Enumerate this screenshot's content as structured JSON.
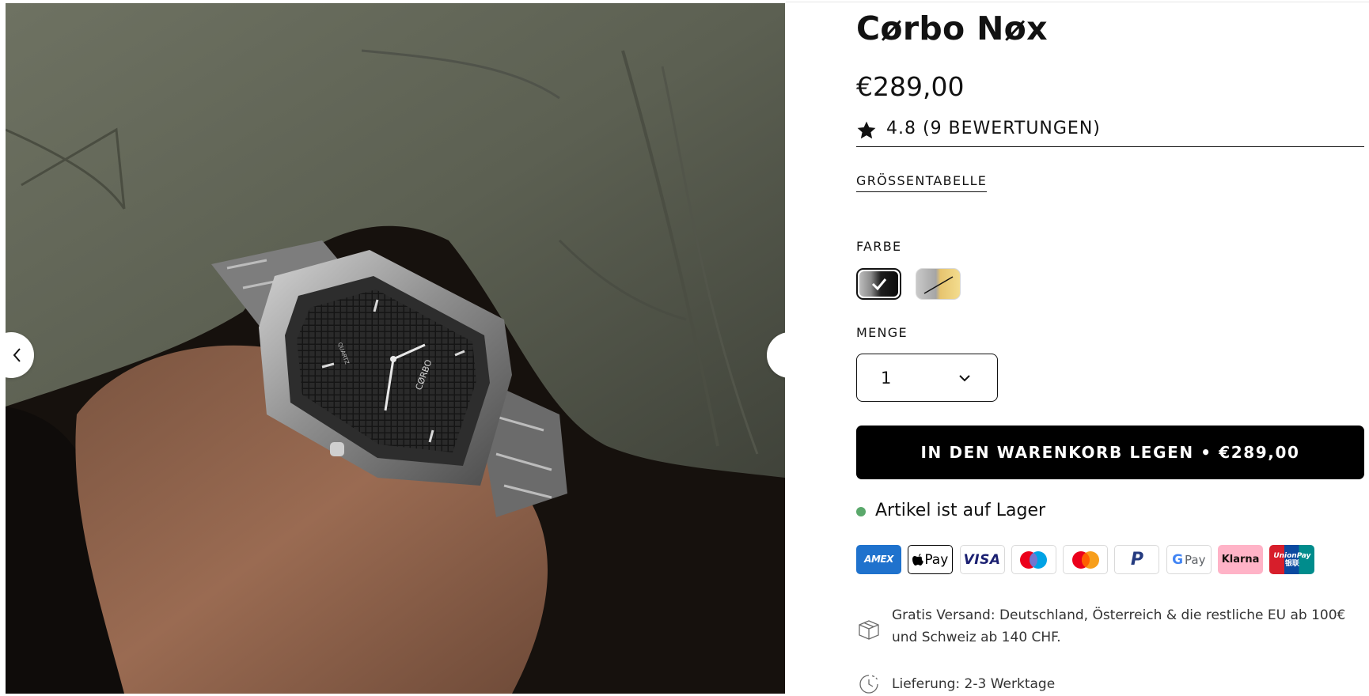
{
  "product": {
    "title": "Cørbo Nøx",
    "price": "€289,00",
    "rating_text": "4.8 (9 BEWERTUNGEN)",
    "size_chart_label": "GRÖSSENTABELLE"
  },
  "options": {
    "color_label": "FARBE",
    "colors": [
      {
        "name": "black",
        "selected": true
      },
      {
        "name": "gold",
        "selected": false,
        "sold_out": true
      }
    ],
    "quantity_label": "MENGE",
    "quantity_value": "1"
  },
  "cart": {
    "button_label": "IN DEN WARENKORB LEGEN • €289,00"
  },
  "stock": {
    "text": "Artikel ist auf Lager",
    "color": "#5aa86b"
  },
  "payments": {
    "amex": "AMEX",
    "applepay": "Pay",
    "visa": "VISA",
    "paypal": "P",
    "gpay": "Pay",
    "gpay_g": "G",
    "klarna": "Klarna",
    "unionpay_1": "UnionPay",
    "unionpay_2": "银联"
  },
  "shipping": {
    "free_shipping_text": "Gratis Versand: Deutschland, Österreich & die restliche EU ab 100€ und Schweiz ab 140 CHF.",
    "delivery_text": "Lieferung: 2-3 Werktage"
  },
  "watch_face": {
    "brand_text": "CØRBO",
    "quartz_text": "QUARTZ"
  },
  "icons": {
    "gallery_prev": "chevron-left-icon",
    "gallery_next": "chevron-right-icon",
    "rating": "star-icon",
    "quantity": "chevron-down-icon",
    "shipping": "package-icon",
    "delivery": "clock-icon"
  }
}
